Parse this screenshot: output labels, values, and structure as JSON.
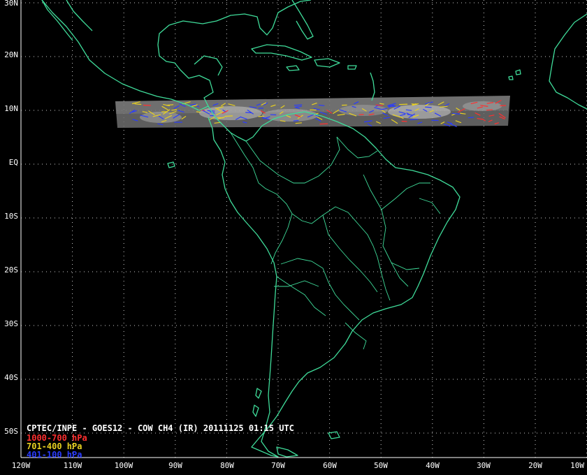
{
  "title": "CPTEC/INPE - GOES12 - COW CH4 (IR) 20111125 01:15 UTC",
  "legend": [
    {
      "label": "1000-700 hPa",
      "color": "#ff3030"
    },
    {
      "label": "701-400 hPa",
      "color": "#e8d020"
    },
    {
      "label": "401-100 hPa",
      "color": "#2a3cff"
    }
  ],
  "lat_labels": [
    "30N",
    "20N",
    "10N",
    "EQ",
    "10S",
    "20S",
    "30S",
    "40S",
    "50S"
  ],
  "lon_labels": [
    "120W",
    "110W",
    "100W",
    "90W",
    "80W",
    "70W",
    "60W",
    "50W",
    "40W",
    "30W",
    "20W",
    "10W"
  ],
  "colors": {
    "background": "#000000",
    "coastline": "#3fdc9a",
    "grid": "#ffffff",
    "labels": "#ffffff"
  }
}
